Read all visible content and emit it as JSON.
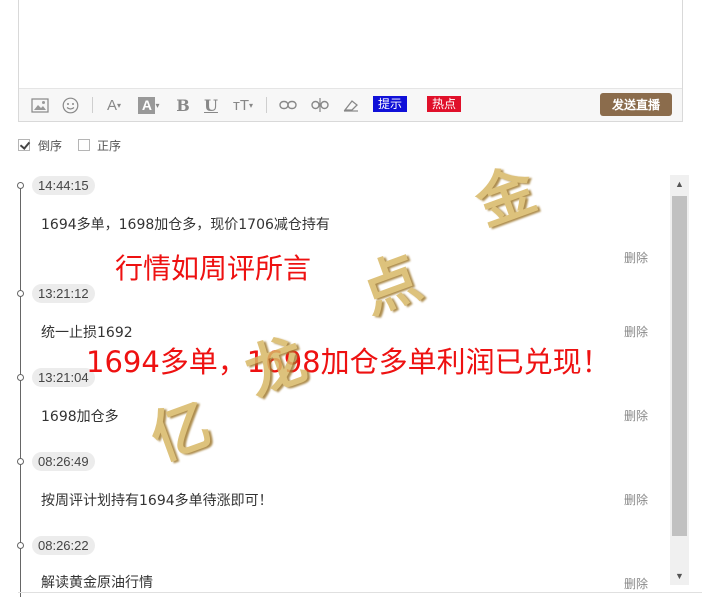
{
  "toolbar": {
    "tip_tag": "提示",
    "hot_tag": "热点",
    "send_label": "发送直播"
  },
  "order": {
    "reverse_label": "倒序",
    "reverse_checked": true,
    "forward_label": "正序",
    "forward_checked": false
  },
  "entries": [
    {
      "time": "14:44:15",
      "text": "1694多单，1698加仓多，现价1706减仓持有",
      "delete": "删除"
    },
    {
      "time": "13:21:12",
      "text": "统一止损1692",
      "delete": "删除"
    },
    {
      "time": "13:21:04",
      "text": "1698加仓多",
      "delete": "删除"
    },
    {
      "time": "08:26:49",
      "text": "按周评计划持有1694多单待涨即可！",
      "delete": "删除"
    },
    {
      "time": "08:26:22",
      "text": "解读黄金原油行情",
      "delete": "删除"
    }
  ],
  "overlay": {
    "line1": "行情如周评所言",
    "line2": "1694多单，1698加仓多单利润已兑现！"
  },
  "watermark": {
    "chars": [
      "亿",
      "龙",
      "点",
      "金"
    ],
    "color": "#d8b866"
  },
  "colors": {
    "send_button": "#8b6c4c",
    "tip_tag": "#1010d8",
    "hot_tag": "#e0102a",
    "overlay_text": "#ee1111"
  }
}
